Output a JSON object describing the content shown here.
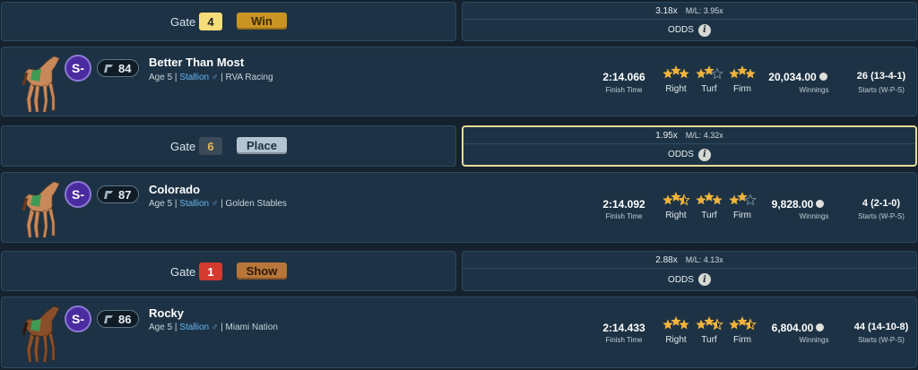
{
  "colors": {
    "gate4": "#f5dd7a",
    "gate6": "#3a4a58",
    "gate1": "#d43a2f",
    "win": "#c99424",
    "place": "#b3c3d1",
    "show": "#b8763a",
    "selected_border": "#e9d99a",
    "star": "#f2b43a",
    "star_empty": "#6c8797"
  },
  "rows": [
    {
      "gate": {
        "label": "Gate",
        "number": "4",
        "position": "Win"
      },
      "odds": {
        "value": "3.18x",
        "ml": "M/L: 3.95x",
        "label": "ODDS",
        "selected": false
      },
      "horse": {
        "grade": "S-",
        "rating": "84",
        "name": "Better Than Most",
        "info_prefix": "Age 5 |",
        "sex": "Stallion ♂",
        "info_suffix": "| RVA Racing",
        "coat": "chestnut"
      },
      "stats": {
        "finish_time": "2:14.066",
        "finish_time_label": "Finish Time",
        "right": {
          "label": "Right",
          "stars": 3
        },
        "turf": {
          "label": "Turf",
          "stars": 2
        },
        "firm": {
          "label": "Firm",
          "stars": 3
        },
        "winnings": "20,034.00",
        "winnings_label": "Winnings",
        "starts": "26 (13-4-1)",
        "starts_label": "Starts (W-P-S)"
      }
    },
    {
      "gate": {
        "label": "Gate",
        "number": "6",
        "position": "Place"
      },
      "odds": {
        "value": "1.95x",
        "ml": "M/L: 4.32x",
        "label": "ODDS",
        "selected": true
      },
      "horse": {
        "grade": "S-",
        "rating": "87",
        "name": "Colorado",
        "info_prefix": "Age 5 |",
        "sex": "Stallion ♂",
        "info_suffix": "| Golden Stables",
        "coat": "chestnut"
      },
      "stats": {
        "finish_time": "2:14.092",
        "finish_time_label": "Finish Time",
        "right": {
          "label": "Right",
          "stars": 2.5
        },
        "turf": {
          "label": "Turf",
          "stars": 3
        },
        "firm": {
          "label": "Firm",
          "stars": 2
        },
        "winnings": "9,828.00",
        "winnings_label": "Winnings",
        "starts": "4 (2-1-0)",
        "starts_label": "Starts (W-P-S)"
      }
    },
    {
      "gate": {
        "label": "Gate",
        "number": "1",
        "position": "Show"
      },
      "odds": {
        "value": "2.88x",
        "ml": "M/L: 4.13x",
        "label": "ODDS",
        "selected": false
      },
      "horse": {
        "grade": "S-",
        "rating": "86",
        "name": "Rocky",
        "info_prefix": "Age 5 |",
        "sex": "Stallion ♂",
        "info_suffix": "| Miami Nation",
        "coat": "bay"
      },
      "stats": {
        "finish_time": "2:14.433",
        "finish_time_label": "Finish Time",
        "right": {
          "label": "Right",
          "stars": 3
        },
        "turf": {
          "label": "Turf",
          "stars": 2.5
        },
        "firm": {
          "label": "Firm",
          "stars": 2.5
        },
        "winnings": "6,804.00",
        "winnings_label": "Winnings",
        "starts": "44 (14-10-8)",
        "starts_label": "Starts (W-P-S)"
      }
    }
  ]
}
